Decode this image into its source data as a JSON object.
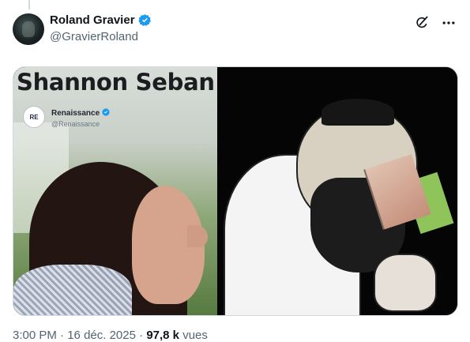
{
  "author": {
    "display_name": "Roland Gravier",
    "handle": "@GravierRoland",
    "verified": true,
    "verified_color": "#1d9bf0"
  },
  "actions": {
    "grok_icon": "grok-icon",
    "more_icon": "more-icon"
  },
  "media": {
    "overlay_title": "Shannon Seban",
    "embedded_account": {
      "name": "Renaissance",
      "handle": "@Renaissance",
      "logo_text": "RE"
    }
  },
  "meta": {
    "time": "3:00 PM",
    "date": "16 déc. 2025",
    "views_count": "97,8 k",
    "views_label": "vues",
    "separator": "·"
  }
}
